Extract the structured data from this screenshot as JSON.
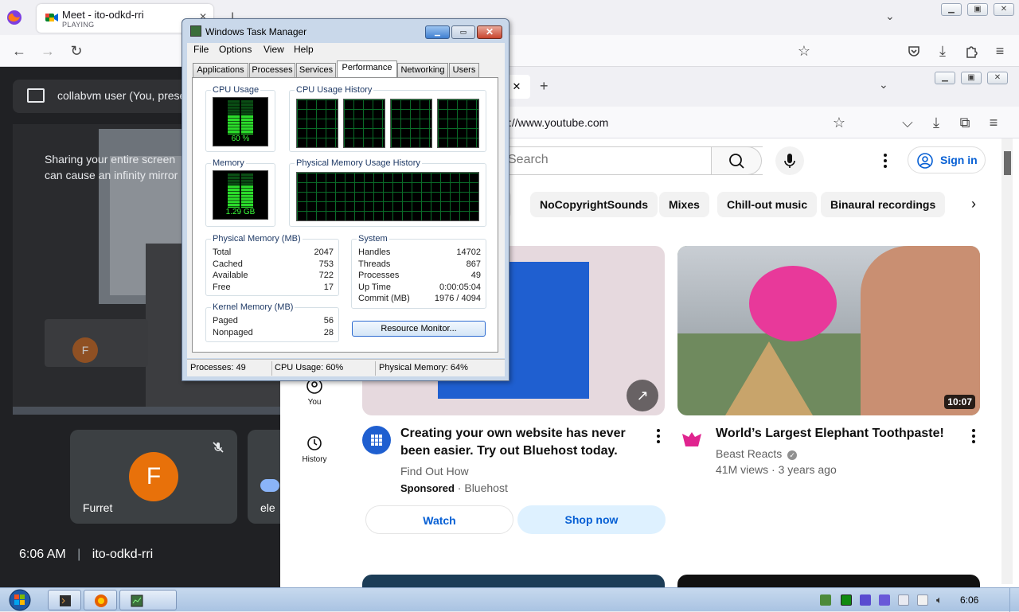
{
  "outer_browser": {
    "tab_title": "Meet - ito-odkd-rri",
    "tab_status": "PLAYING",
    "icons": [
      "firefox-icon",
      "back-icon",
      "forward-icon",
      "reload-icon",
      "bookmark-star-icon",
      "pocket-icon",
      "downloads-icon",
      "extensions-icon",
      "menu-icon"
    ]
  },
  "meet": {
    "presenter_text": "collabvm user (You, presenting)",
    "share_warning": "Sharing your entire screen can cause an infinity mirror",
    "tiles": [
      {
        "name": "Furret",
        "avatar_letter": "F",
        "avatar_color": "#e8710a",
        "mic_muted": true
      },
      {
        "name": "ele"
      }
    ],
    "mirror_avatar_letter": "F",
    "time": "6:06 AM",
    "divider": "|",
    "meeting_code": "ito-odkd-rri"
  },
  "task_manager": {
    "title": "Windows Task Manager",
    "menu": [
      "File",
      "Options",
      "View",
      "Help"
    ],
    "tabs": [
      "Applications",
      "Processes",
      "Services",
      "Performance",
      "Networking",
      "Users"
    ],
    "active_tab": "Performance",
    "cpu_usage_label": "CPU Usage",
    "cpu_usage_value": "60 %",
    "cpu_usage_fraction": 0.6,
    "cpu_history_label": "CPU Usage History",
    "memory_label": "Memory",
    "memory_value": "1.29 GB",
    "memory_fraction": 0.64,
    "memory_history_label": "Physical Memory Usage History",
    "physical_memory": {
      "label": "Physical Memory (MB)",
      "rows": [
        {
          "k": "Total",
          "v": "2047"
        },
        {
          "k": "Cached",
          "v": "753"
        },
        {
          "k": "Available",
          "v": "722"
        },
        {
          "k": "Free",
          "v": "17"
        }
      ]
    },
    "kernel_memory": {
      "label": "Kernel Memory (MB)",
      "rows": [
        {
          "k": "Paged",
          "v": "56"
        },
        {
          "k": "Nonpaged",
          "v": "28"
        }
      ]
    },
    "system": {
      "label": "System",
      "rows": [
        {
          "k": "Handles",
          "v": "14702"
        },
        {
          "k": "Threads",
          "v": "867"
        },
        {
          "k": "Processes",
          "v": "49"
        },
        {
          "k": "Up Time",
          "v": "0:00:05:04"
        },
        {
          "k": "Commit (MB)",
          "v": "1976 / 4094"
        }
      ]
    },
    "resource_monitor_button": "Resource Monitor...",
    "status": {
      "processes": "Processes: 49",
      "cpu": "CPU Usage: 60%",
      "memory": "Physical Memory: 64%"
    }
  },
  "youtube": {
    "url": "s://www.youtube.com",
    "search_placeholder": "Search",
    "sign_in": "Sign in",
    "chips": [
      "NoCopyrightSounds",
      "Mixes",
      "Chill-out music",
      "Binaural recordings"
    ],
    "side_nav": [
      {
        "label": "You",
        "icon": "user-circle-icon"
      },
      {
        "label": "History",
        "icon": "history-icon"
      }
    ],
    "videos": [
      {
        "title": "Creating your own website has never been easier. Try out Bluehost today.",
        "channel": "Find Out How",
        "sponsored_label": "Sponsored",
        "sponsor_sep": "·",
        "sponsor": "Bluehost",
        "buttons": [
          "Watch",
          "Shop now"
        ]
      },
      {
        "title": "World’s Largest Elephant Toothpaste!",
        "channel": "Beast Reacts",
        "meta": "41M views · 3 years ago",
        "duration": "10:07"
      }
    ]
  },
  "taskbar": {
    "clock": "6:06",
    "tray_icons": [
      "network-icon",
      "task-manager-tray-icon",
      "mic-icon",
      "window-icon",
      "window2-icon",
      "document-icon",
      "monitor-icon",
      "volume-icon"
    ]
  },
  "colors": {
    "meet_bg": "#202124",
    "youtube_link": "#065fd4",
    "graph_green": "#3aff3a",
    "taskbar": "#b9cfe8"
  }
}
